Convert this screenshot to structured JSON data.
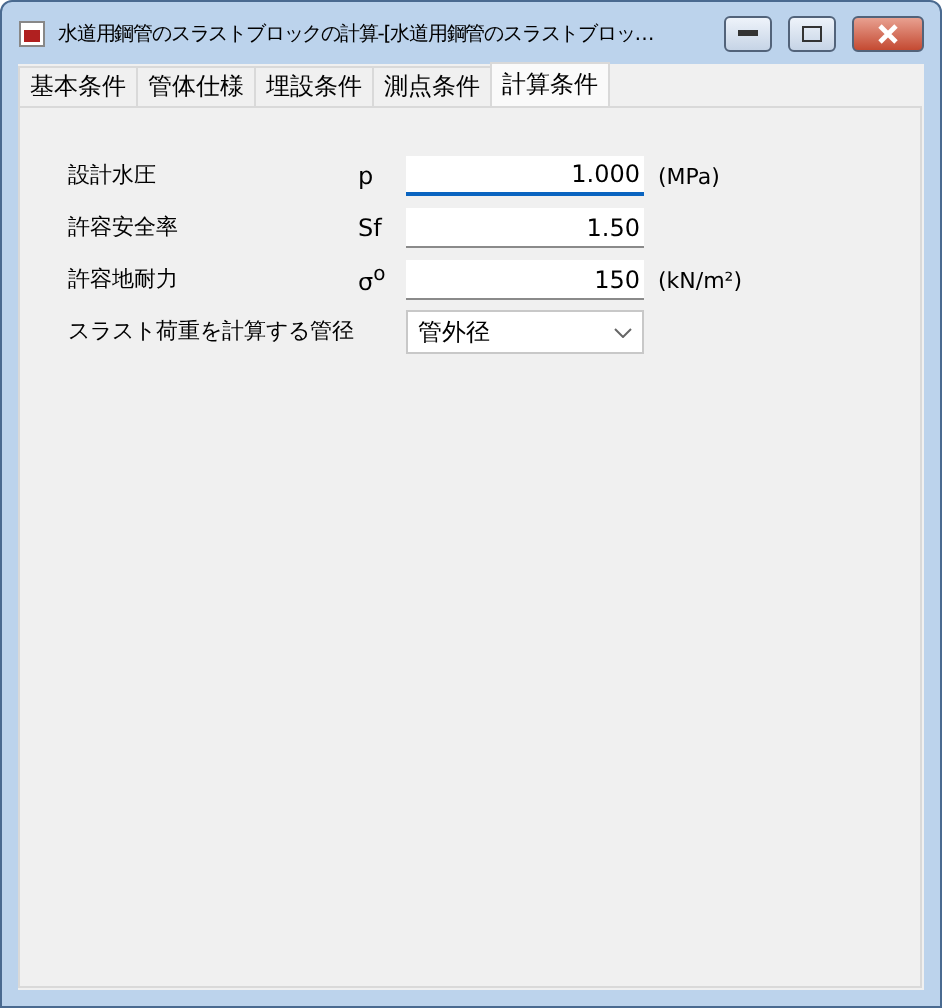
{
  "window": {
    "title": "水道用鋼管のスラストブロックの計算-[水道用鋼管のスラストブロッ…"
  },
  "tabs": [
    {
      "label": "基本条件",
      "selected": false
    },
    {
      "label": "管体仕様",
      "selected": false
    },
    {
      "label": "埋設条件",
      "selected": false
    },
    {
      "label": "測点条件",
      "selected": false
    },
    {
      "label": "計算条件",
      "selected": true
    }
  ],
  "fields": [
    {
      "kind": "input",
      "label": "設計水圧",
      "symbol": "p",
      "value": "1.000",
      "unit": "(MPa)",
      "focused": true
    },
    {
      "kind": "input",
      "label": "許容安全率",
      "symbol": "Sf",
      "value": "1.50",
      "focused": false
    },
    {
      "kind": "input",
      "label": "許容地耐力",
      "symbol": "σ$^{o}$",
      "value": "150",
      "unit": "(kN/m²)",
      "focused": false
    },
    {
      "kind": "select",
      "label": "スラスト荷重を計算する管径",
      "value": "管外径"
    }
  ]
}
